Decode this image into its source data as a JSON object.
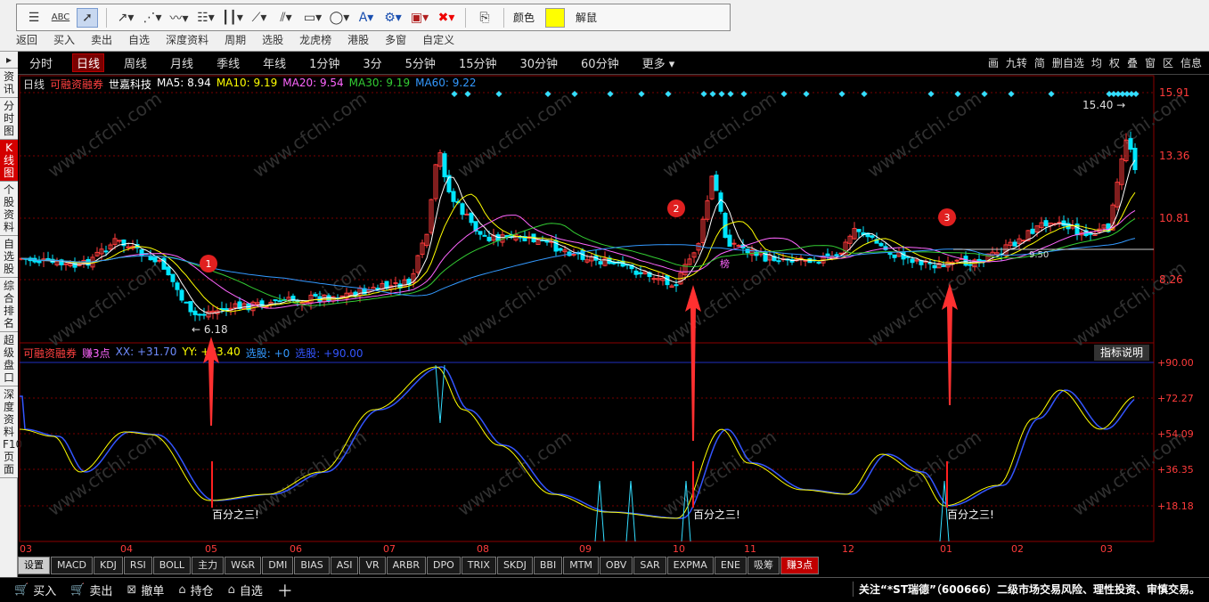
{
  "toolbar": {
    "color_label": "颜色",
    "unlock_label": "解鼠",
    "icons": [
      "cursor-icon",
      "horizontal-lines-icon",
      "abc-tool-icon",
      "pointer-icon",
      "line-arrow-icon",
      "dotted-line-icon",
      "wave-icon",
      "fib-lines-icon",
      "vertical-bars-icon",
      "fan-lines-icon",
      "parallel-icon",
      "rectangle-icon",
      "circle-icon",
      "text-icon",
      "gear-icon",
      "save-icon",
      "delete-icon",
      "export-icon"
    ]
  },
  "top_menu": [
    "返回",
    "买入",
    "卖出",
    "自选",
    "深度资料",
    "周期",
    "选股",
    "龙虎榜",
    "港股",
    "多窗",
    "自定义"
  ],
  "left_nav": [
    "资讯",
    "分时图",
    "K线图",
    "个股资料",
    "自选股",
    "综合排名",
    "超级盘口",
    "深度资料F10页面"
  ],
  "periods": [
    "分时",
    "日线",
    "周线",
    "月线",
    "季线",
    "年线",
    "1分钟",
    "3分",
    "5分钟",
    "15分钟",
    "30分钟",
    "60分钟",
    "更多"
  ],
  "right_menu": [
    "画",
    "九转",
    "简",
    "删自选",
    "均",
    "权",
    "叠",
    "窗",
    "区",
    "信息"
  ],
  "main_info": {
    "period": "日线",
    "tag": "可融资融券",
    "stock": "世嘉科技",
    "ma5": "MA5: 8.94",
    "ma10": "MA10: 9.19",
    "ma20": "MA20: 9.54",
    "ma30": "MA30: 9.19",
    "ma60": "MA60: 9.22"
  },
  "price_axis": [
    "15.91",
    "13.36",
    "10.81",
    "8.26"
  ],
  "annotations": {
    "high": "15.40",
    "low": "6.18",
    "mid_label": "9.50",
    "bang": "榜",
    "circles": [
      "1",
      "2",
      "3"
    ]
  },
  "sub_info": {
    "tag": "可融资融券",
    "name": "赚3点",
    "xx": "XX: +31.70",
    "yy": "YY: +33.40",
    "select": "选股: +0",
    "select2": "选股: +90.00"
  },
  "sub_axis": [
    "+90.00",
    "+72.27",
    "+54.09",
    "+36.35",
    "+18.18"
  ],
  "explain_button": "指标说明",
  "percent_labels": [
    "百分之三!",
    "百分之三!",
    "百分之三!"
  ],
  "months": [
    "03",
    "04",
    "05",
    "06",
    "07",
    "08",
    "09",
    "10",
    "11",
    "12",
    "01",
    "02",
    "03"
  ],
  "tabs": [
    "设置",
    "MACD",
    "KDJ",
    "RSI",
    "BOLL",
    "主力",
    "W&R",
    "DMI",
    "BIAS",
    "ASI",
    "VR",
    "ARBR",
    "DPO",
    "TRIX",
    "SKDJ",
    "BBI",
    "MTM",
    "OBV",
    "SAR",
    "EXPMA",
    "ENE",
    "吸筹",
    "赚3点"
  ],
  "bottom": [
    "买入",
    "卖出",
    "撤单",
    "持仓",
    "自选"
  ],
  "ticker": "关注“*ST瑞德”（600666）二级市场交易风险、理性投资、审慎交易。",
  "watermark": "www.cfchi.com",
  "colors": {
    "up": "#ff3b3b",
    "down": "#00e6ff",
    "ma5": "#ffffff",
    "ma10": "#ffff00",
    "ma20": "#ff66ff",
    "ma30": "#33cc33",
    "ma60": "#3399ff",
    "active": "#c00000"
  }
}
